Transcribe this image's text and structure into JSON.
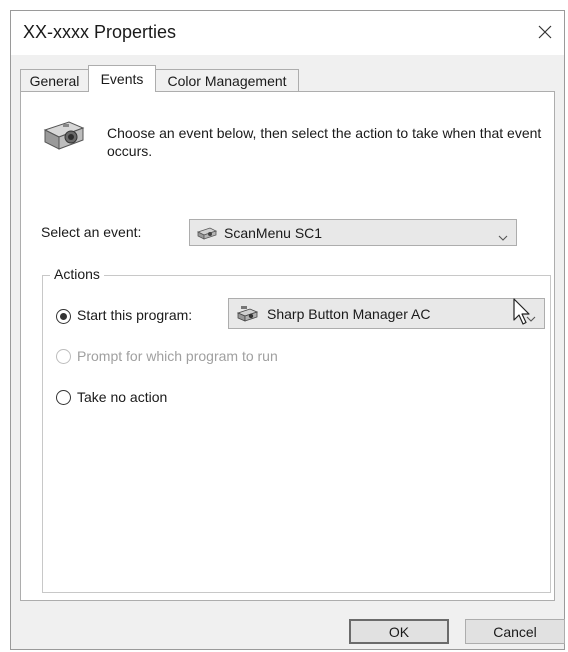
{
  "window": {
    "title": "XX-xxxx  Properties"
  },
  "tabs": [
    {
      "label": "General",
      "active": false
    },
    {
      "label": "Events",
      "active": true
    },
    {
      "label": "Color Management",
      "active": false
    }
  ],
  "events_tab": {
    "intro": "Choose an event below, then select the action to take when that event occurs.",
    "select_event_label": "Select an event:",
    "select_event_value": "ScanMenu SC1",
    "actions_group": {
      "title": "Actions",
      "start_program_label": "Start this program:",
      "start_program_value": "Sharp Button Manager AC",
      "start_program_checked": true,
      "prompt_label": "Prompt for which program to run",
      "prompt_disabled": true,
      "no_action_label": "Take no action",
      "no_action_checked": false
    }
  },
  "buttons": {
    "ok": "OK",
    "cancel": "Cancel"
  },
  "icons": {
    "close": "close-icon",
    "camera": "camera-icon",
    "scanner": "scanner-icon",
    "program": "program-icon",
    "dropdown": "chevron-down-icon",
    "cursor": "mouse-pointer-icon"
  }
}
